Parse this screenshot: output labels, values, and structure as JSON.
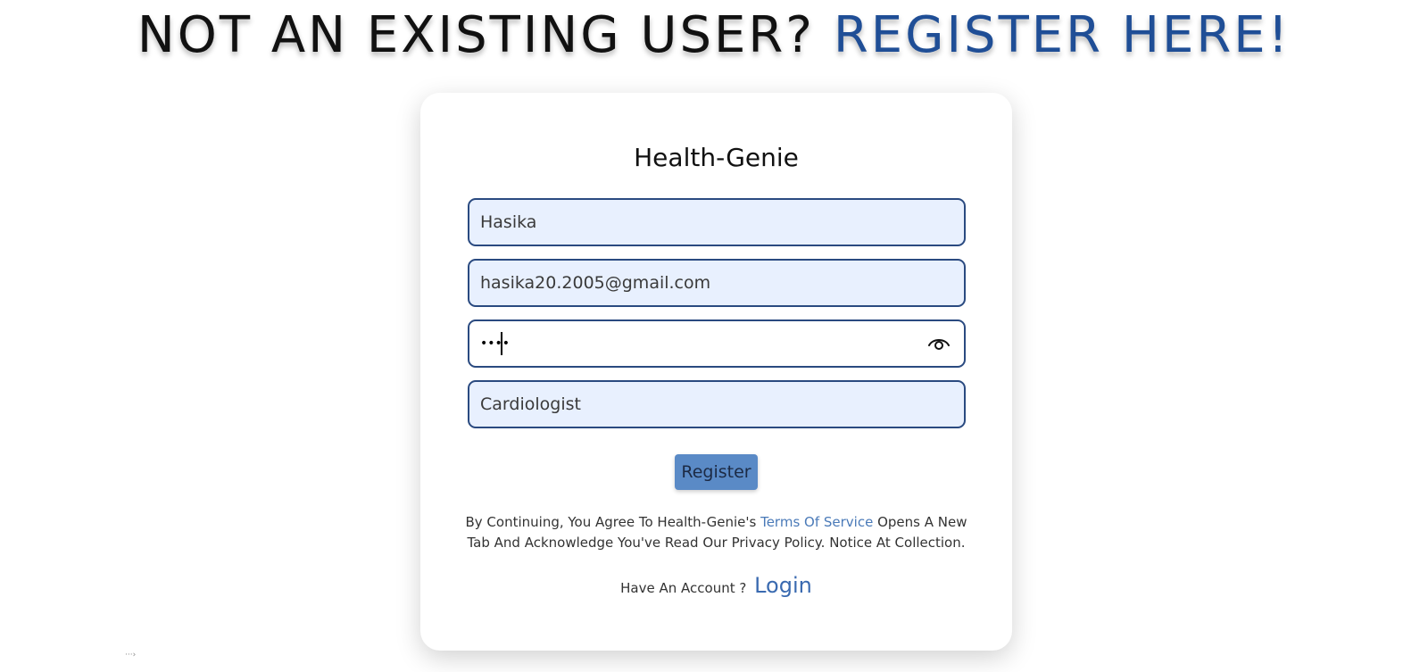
{
  "headline": {
    "prefix": "NOT AN EXISTING USER?",
    "link": "REGISTER HERE!"
  },
  "card": {
    "brand": "Health-Genie",
    "fields": {
      "name": "Hasika",
      "email": "hasika20.2005@gmail.com",
      "password_mask": "••••",
      "specialization": "Cardiologist"
    },
    "register_label": "Register",
    "terms": {
      "before": "By Continuing, You Agree To Health-Genie's ",
      "link": "Terms Of Service",
      "after": " Opens A New Tab And Acknowledge You've Read Our Privacy Policy. Notice At Collection."
    },
    "have_account": "Have An Account ?",
    "login_label": "Login"
  },
  "icons": {
    "password_toggle": "eye-icon"
  },
  "colors": {
    "accent": "#1f4e96",
    "field_bg": "#e8f0fe",
    "field_border": "#2a4a80",
    "button_bg": "#5a8ac6",
    "link": "#4a7ab8"
  }
}
